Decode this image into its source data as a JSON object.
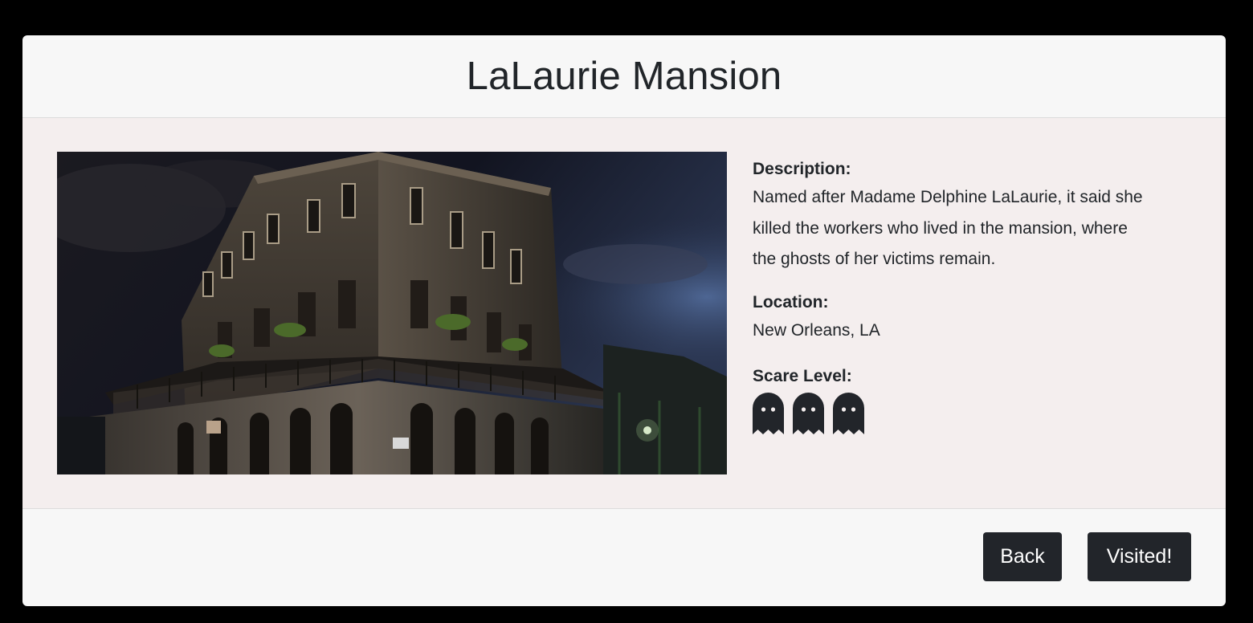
{
  "modal": {
    "title": "LaLaurie Mansion"
  },
  "details": {
    "description_label": "Description:",
    "description_lines": [
      "Named after Madame Delphine LaLaurie, it said she",
      "killed the workers who lived in the mansion, where",
      "the ghosts of her victims remain."
    ],
    "location_label": "Location:",
    "location_value": "New Orleans, LA",
    "scare_label": "Scare Level:",
    "scare_level": 3,
    "scare_icon": "ghost-icon"
  },
  "footer": {
    "back_label": "Back",
    "visited_label": "Visited!"
  },
  "colors": {
    "page_bg": "#000000",
    "modal_bg": "#f7f7f7",
    "body_bg": "#f4eeee",
    "button_bg": "#22252a",
    "text": "#212529"
  }
}
